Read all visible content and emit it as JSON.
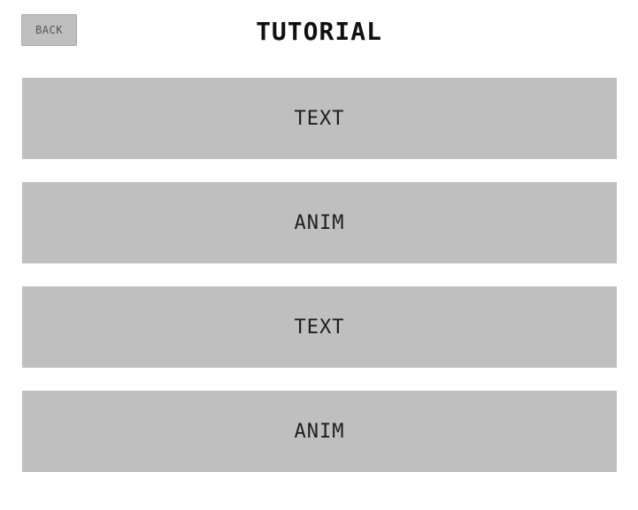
{
  "header": {
    "back_label": "BACK",
    "title": "TUTORIAL"
  },
  "menu": {
    "items": [
      {
        "label": "TEXT"
      },
      {
        "label": "ANIM"
      },
      {
        "label": "TEXT"
      },
      {
        "label": "ANIM"
      }
    ]
  },
  "colors": {
    "background": "#ffffff",
    "button_fill": "#bfbfbf",
    "text": "#1e1e1e"
  }
}
